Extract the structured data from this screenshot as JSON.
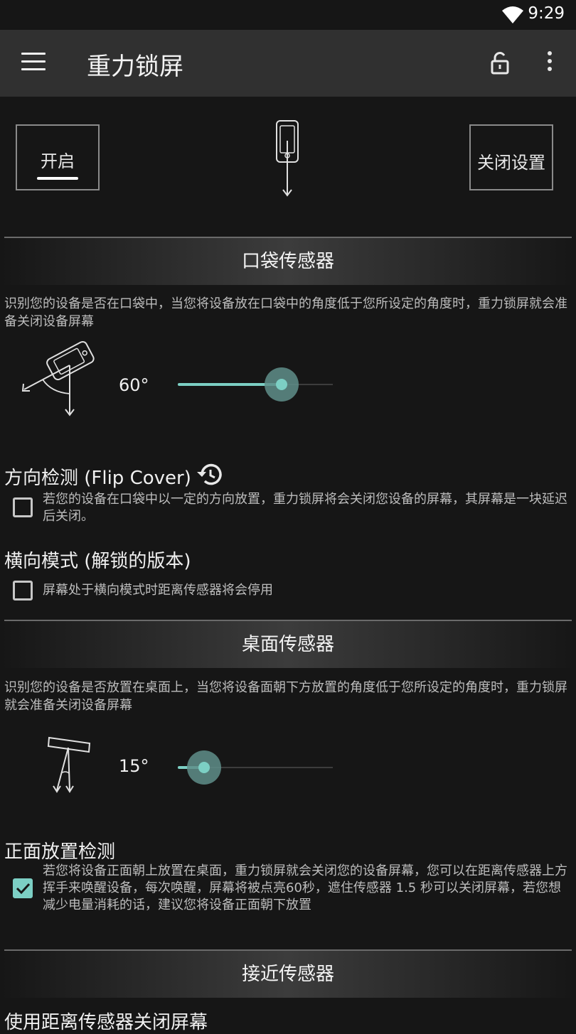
{
  "status_bar": {
    "time": "9:29",
    "wifi_icon": "wifi-icon"
  },
  "app_bar": {
    "title": "重力锁屏",
    "menu_icon": "menu-icon",
    "lock_icon": "unlock-icon",
    "more_icon": "more-vert-icon"
  },
  "controls": {
    "start_label": "开启",
    "stop_label": "关闭设置"
  },
  "pocket": {
    "header": "口袋传感器",
    "description": "识别您的设备是否在口袋中，当您将设备放在口袋中的角度低于您所设定的角度时，重力锁屏就会准备关闭设备屏幕",
    "angle_label": "60°",
    "slider_fraction": 0.67
  },
  "flip_cover": {
    "title": "方向检测 (Flip Cover)",
    "checked": false,
    "description": "若您的设备在口袋中以一定的方向放置，重力锁屏将会关闭您设备的屏幕，其屏幕是一块延迟后关闭。"
  },
  "landscape": {
    "title": "横向模式 (解锁的版本)",
    "checked": false,
    "description": "屏幕处于横向模式时距离传感器将会停用"
  },
  "table": {
    "header": "桌面传感器",
    "description": "识别您的设备是否放置在桌面上，当您将设备面朝下方放置的角度低于您所设定的角度时，重力锁屏就会准备关闭设备屏幕",
    "angle_label": "15°",
    "slider_fraction": 0.17
  },
  "face_up": {
    "title": "正面放置检测",
    "checked": true,
    "description": "若您将设备正面朝上放置在桌面，重力锁屏就会关闭您的设备屏幕，您可以在距离传感器上方挥手来唤醒设备，每次唤醒，屏幕将被点亮60秒，遮住传感器 1.5 秒可以关闭屏幕，若您想减少电量消耗的话，建议您将设备正面朝下放置"
  },
  "proximity": {
    "header": "接近传感器",
    "next_title": "使用距离传感器关闭屏幕"
  },
  "colors": {
    "accent": "#7ccfc4",
    "background": "#161616",
    "app_bar": "#303030"
  }
}
